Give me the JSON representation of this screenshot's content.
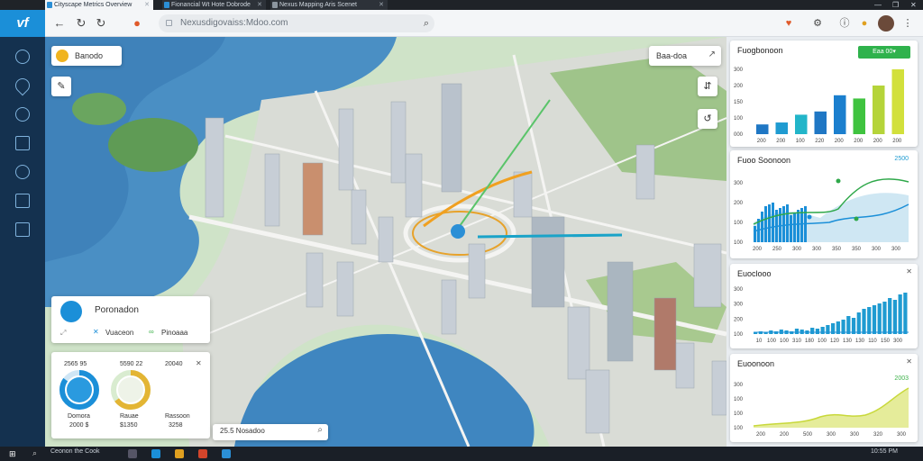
{
  "browser": {
    "tabs": [
      {
        "label": "Cityscape Metrics Overview"
      },
      {
        "label": "Fionancial Wt Hote Dobrode"
      },
      {
        "label": "Nexus Mapping Aris Scenet"
      }
    ],
    "url": "Nexusdigovaiss:Mdoo.com",
    "window_controls": [
      "—",
      "❐",
      "✕"
    ]
  },
  "app": {
    "logo_text": "vf",
    "rail_icons": [
      "compass-icon",
      "pin-icon",
      "shield-icon",
      "window-icon",
      "globe-icon",
      "calendar-icon",
      "lock-icon"
    ]
  },
  "map": {
    "top_left_label": "Banodo",
    "top_right_label": "Baa-doa",
    "info_card": {
      "title": "Poronadon",
      "action1": "Vuaceon",
      "action2": "Pinoaaa"
    },
    "stats_card": {
      "col1_value": "2565 95",
      "col2_value": "5590 22",
      "col3_value": "20040",
      "col1_label": "Domora",
      "col1_sub": "2000 $",
      "col2_label": "Rauae",
      "col2_sub": "$1350",
      "col3_label": "Rassoon",
      "col3_sub": "3258",
      "gauge1_pct": 0.85,
      "gauge2_pct": 0.65
    },
    "bottom_strip": "25.5 Nosadoo"
  },
  "right_panel": {
    "card1": {
      "title": "Fuogbonoon",
      "button": "Eaa 00▾",
      "accent": "#2fb24c"
    },
    "card2": {
      "title": "Fuoo Soonoon",
      "legend": "2500"
    },
    "card3": {
      "title": "Euoclooo"
    },
    "card4": {
      "title": "Euoonoon",
      "legend": "2003"
    }
  },
  "chart_data": [
    {
      "type": "bar",
      "title": "Fuogbonoon",
      "yticks": [
        "300",
        "200",
        "150",
        "100",
        "000"
      ],
      "categories": [
        "200",
        "200",
        "100",
        "220",
        "200",
        "200",
        "200",
        "200"
      ],
      "values": [
        0.15,
        0.18,
        0.3,
        0.35,
        0.6,
        0.55,
        0.75,
        1.0
      ],
      "colors": [
        "#1f77c4",
        "#1f9bd1",
        "#22b5c9",
        "#1f77c4",
        "#1b7fce",
        "#3fc33f",
        "#b5d43a",
        "#d2e03b"
      ]
    },
    {
      "type": "line",
      "title": "Fuoo Soonoon",
      "yticks": [
        "300",
        "200",
        "100",
        "100"
      ],
      "xticks": [
        "200",
        "250",
        "300",
        "300",
        "350",
        "350",
        "300",
        "300"
      ]
    },
    {
      "type": "bar",
      "title": "Euoclooo",
      "yticks": [
        "300",
        "300",
        "200",
        "100"
      ],
      "xticks": [
        "10",
        "100",
        "100",
        "310",
        "180",
        "100",
        "120",
        "130",
        "130",
        "110",
        "150",
        "300"
      ]
    },
    {
      "type": "area",
      "title": "Euoonoon",
      "yticks": [
        "300",
        "100",
        "100",
        "100"
      ],
      "xticks": [
        "200",
        "200",
        "500",
        "300",
        "300",
        "320",
        "300"
      ]
    }
  ],
  "taskbar": {
    "search_text": "Ceonon the Cook",
    "clock": "10:55 PM"
  }
}
